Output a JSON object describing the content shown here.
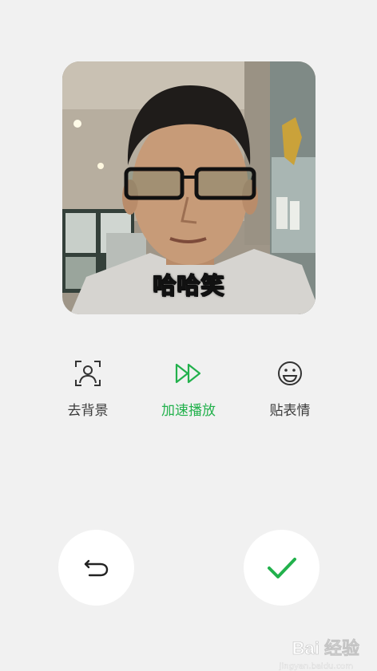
{
  "preview": {
    "caption": "哈哈笑"
  },
  "tools": [
    {
      "label": "去背景",
      "icon": "portrait-frame-icon",
      "active": false
    },
    {
      "label": "加速播放",
      "icon": "fast-forward-icon",
      "active": true
    },
    {
      "label": "贴表情",
      "icon": "smiley-icon",
      "active": false
    }
  ],
  "colors": {
    "background": "#f1f1f1",
    "accent": "#22b14c",
    "label": "#3b3b3b"
  },
  "buttons": {
    "undo_icon": "undo-arrow-icon",
    "confirm_icon": "checkmark-icon"
  },
  "watermark": {
    "brand": "Bai 经验",
    "url": "jingyan.baidu.com"
  }
}
